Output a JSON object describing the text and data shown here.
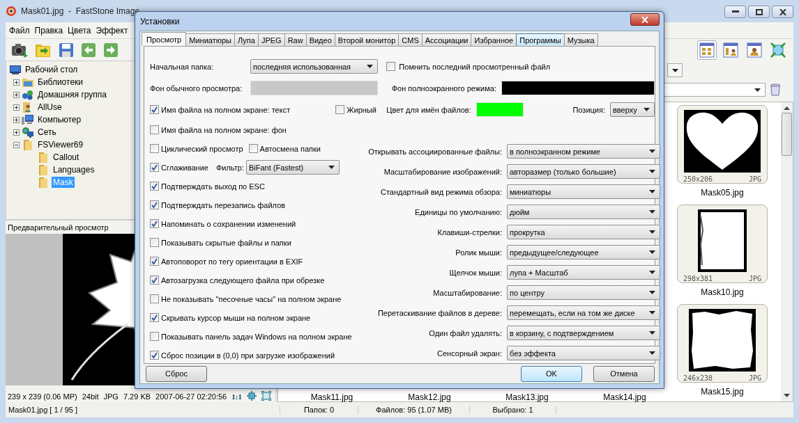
{
  "app": {
    "title": "Mask01.jpg  -  FastStone Image",
    "menu": [
      "Файл",
      "Правка",
      "Цвета",
      "Эффект"
    ],
    "tree": [
      {
        "label": "Рабочий стол",
        "kind": "desktop",
        "selected": false,
        "children": [
          {
            "label": "Библиотеки",
            "kind": "library",
            "expanded": false,
            "selected": false
          },
          {
            "label": "Домашняя группа",
            "kind": "homegroup",
            "expanded": false,
            "selected": false
          },
          {
            "label": "AllUse",
            "kind": "user",
            "expanded": false,
            "selected": false
          },
          {
            "label": "Компьютер",
            "kind": "computer",
            "expanded": false,
            "selected": false
          },
          {
            "label": "Сеть",
            "kind": "network",
            "expanded": false,
            "selected": false
          },
          {
            "label": "FSViewer69",
            "kind": "folder",
            "expanded": true,
            "selected": false,
            "children": [
              {
                "label": "Callout",
                "kind": "folder",
                "selected": false
              },
              {
                "label": "Languages",
                "kind": "folder",
                "selected": false
              },
              {
                "label": "Mask",
                "kind": "folder",
                "selected": true
              }
            ]
          }
        ]
      }
    ],
    "preview": {
      "label": "Предварительный просмотр",
      "kind": "picture"
    },
    "image_info": {
      "dimensions": "239 x 239 (0.06 MP)",
      "depth": "24bit",
      "format": "JPG",
      "file_size": "7.29 KB",
      "date": "2007-06-27 02:20:56",
      "zoom": "1:1"
    },
    "thumbnails": [
      {
        "name": "Mask05.jpg",
        "size": "250x206",
        "format": "JPG"
      },
      {
        "name": "Mask10.jpg",
        "size": "298x381",
        "format": "JPG"
      },
      {
        "name": "Mask15.jpg",
        "size": "246x238",
        "format": "JPG"
      }
    ],
    "thumbnail_labels": [
      "Mask11.jpg",
      "Mask12.jpg",
      "Mask13.jpg",
      "Mask14.jpg"
    ],
    "status_bar": [
      "Mask01.jpg [ 1 / 95 ]",
      "Папок: 0",
      "Файлов: 95 (1.07 MB)",
      "Выбрано: 1"
    ]
  },
  "dialog": {
    "title": "Установки",
    "tabs": [
      {
        "label": "Просмотр",
        "selected": true,
        "highlighted": false
      },
      {
        "label": "Миниатюры",
        "selected": false,
        "highlighted": false
      },
      {
        "label": "Лупа",
        "selected": false,
        "highlighted": false
      },
      {
        "label": "JPEG",
        "selected": false,
        "highlighted": false
      },
      {
        "label": "Raw",
        "selected": false,
        "highlighted": false
      },
      {
        "label": "Видео",
        "selected": false,
        "highlighted": false
      },
      {
        "label": "Второй монитор",
        "selected": false,
        "highlighted": false
      },
      {
        "label": "CMS",
        "selected": false,
        "highlighted": false
      },
      {
        "label": "Ассоциации",
        "selected": false,
        "highlighted": false
      },
      {
        "label": "Избранное",
        "selected": false,
        "highlighted": false
      },
      {
        "label": "Программы",
        "selected": false,
        "highlighted": true
      },
      {
        "label": "Музыка",
        "selected": false,
        "highlighted": false
      }
    ],
    "start_folder": {
      "label": "Начальная папка:",
      "value": "последняя использованная"
    },
    "remember_last": {
      "label": "Помнить последний просмотренный файл",
      "checked": false
    },
    "normal_background": {
      "label": "Фон обычного просмотра:",
      "color": "#c8c8c8"
    },
    "fullscreen_background": {
      "label": "Фон полноэкранного режима:",
      "color": "#000000"
    },
    "filename_text": {
      "label": "Имя файла на полном экране: текст",
      "checked": true
    },
    "bold": {
      "label": "Жирный",
      "checked": false
    },
    "filename_color": {
      "label": "Цвет для имён файлов:",
      "color": "#00ff00"
    },
    "position": {
      "label": "Позиция:",
      "value": "вверху"
    },
    "left_options": [
      {
        "kind": "check",
        "label": "Имя файла на полном экране: фон",
        "checked": false
      },
      {
        "kind": "pair",
        "label": "Циклический просмотр",
        "checked": false,
        "second_label": "Автосмена папки",
        "second_checked": false
      },
      {
        "kind": "filter",
        "label": "Сглаживание",
        "checked": true,
        "filter_label": "Фильтр:",
        "filter_value": "BiFant (Fastest)"
      },
      {
        "kind": "check",
        "label": "Подтверждать выход по ESC",
        "checked": true
      },
      {
        "kind": "check",
        "label": "Подтверждать перезапись файлов",
        "checked": true
      },
      {
        "kind": "check",
        "label": "Напоминать о сохранении изменений",
        "checked": true
      },
      {
        "kind": "check",
        "label": "Показывать скрытые файлы и папки",
        "checked": false
      },
      {
        "kind": "check",
        "label": "Автоповорот по тегу ориентации в EXIF",
        "checked": true
      },
      {
        "kind": "check",
        "label": "Автозагрузка следующего файла при обрезке",
        "checked": true
      },
      {
        "kind": "check",
        "label": "Не показывать \"песочные часы\" на полном экране",
        "checked": false
      },
      {
        "kind": "check",
        "label": "Скрывать курсор мыши на полном экране",
        "checked": true
      },
      {
        "kind": "check",
        "label": "Показывать панель задач Windows на полном экране",
        "checked": false
      },
      {
        "kind": "check",
        "label": "Сброс позиции в (0,0) при загрузке изображений",
        "checked": true
      }
    ],
    "right_options": [
      {
        "label": "Открывать ассоциированные файлы:",
        "value": "в полноэкранном режиме"
      },
      {
        "label": "Масштабирование изображений:",
        "value": "авторазмер (только большие)"
      },
      {
        "label": "Стандартный вид режима обзора:",
        "value": "миниатюры"
      },
      {
        "label": "Единицы по умолчанию:",
        "value": "дюйм"
      },
      {
        "label": "Клавиши-стрелки:",
        "value": "прокрутка"
      },
      {
        "label": "Ролик мыши:",
        "value": "предыдущее/следующее"
      },
      {
        "label": "Щелчок мыши:",
        "value": "лупа + Масштаб"
      },
      {
        "label": "Масштабирование:",
        "value": "по центру"
      },
      {
        "label": "Перетаскивание файлов в дереве:",
        "value": "перемещать, если на том же диске"
      },
      {
        "label": "Один файл удалять:",
        "value": "в корзину, с подтверждением"
      },
      {
        "label": "Сенсорный экран:",
        "value": "без эффекта"
      }
    ],
    "buttons": [
      {
        "label": "Сброс",
        "default": false
      },
      {
        "label": "OK",
        "default": true
      },
      {
        "label": "Отмена",
        "default": false
      }
    ]
  }
}
